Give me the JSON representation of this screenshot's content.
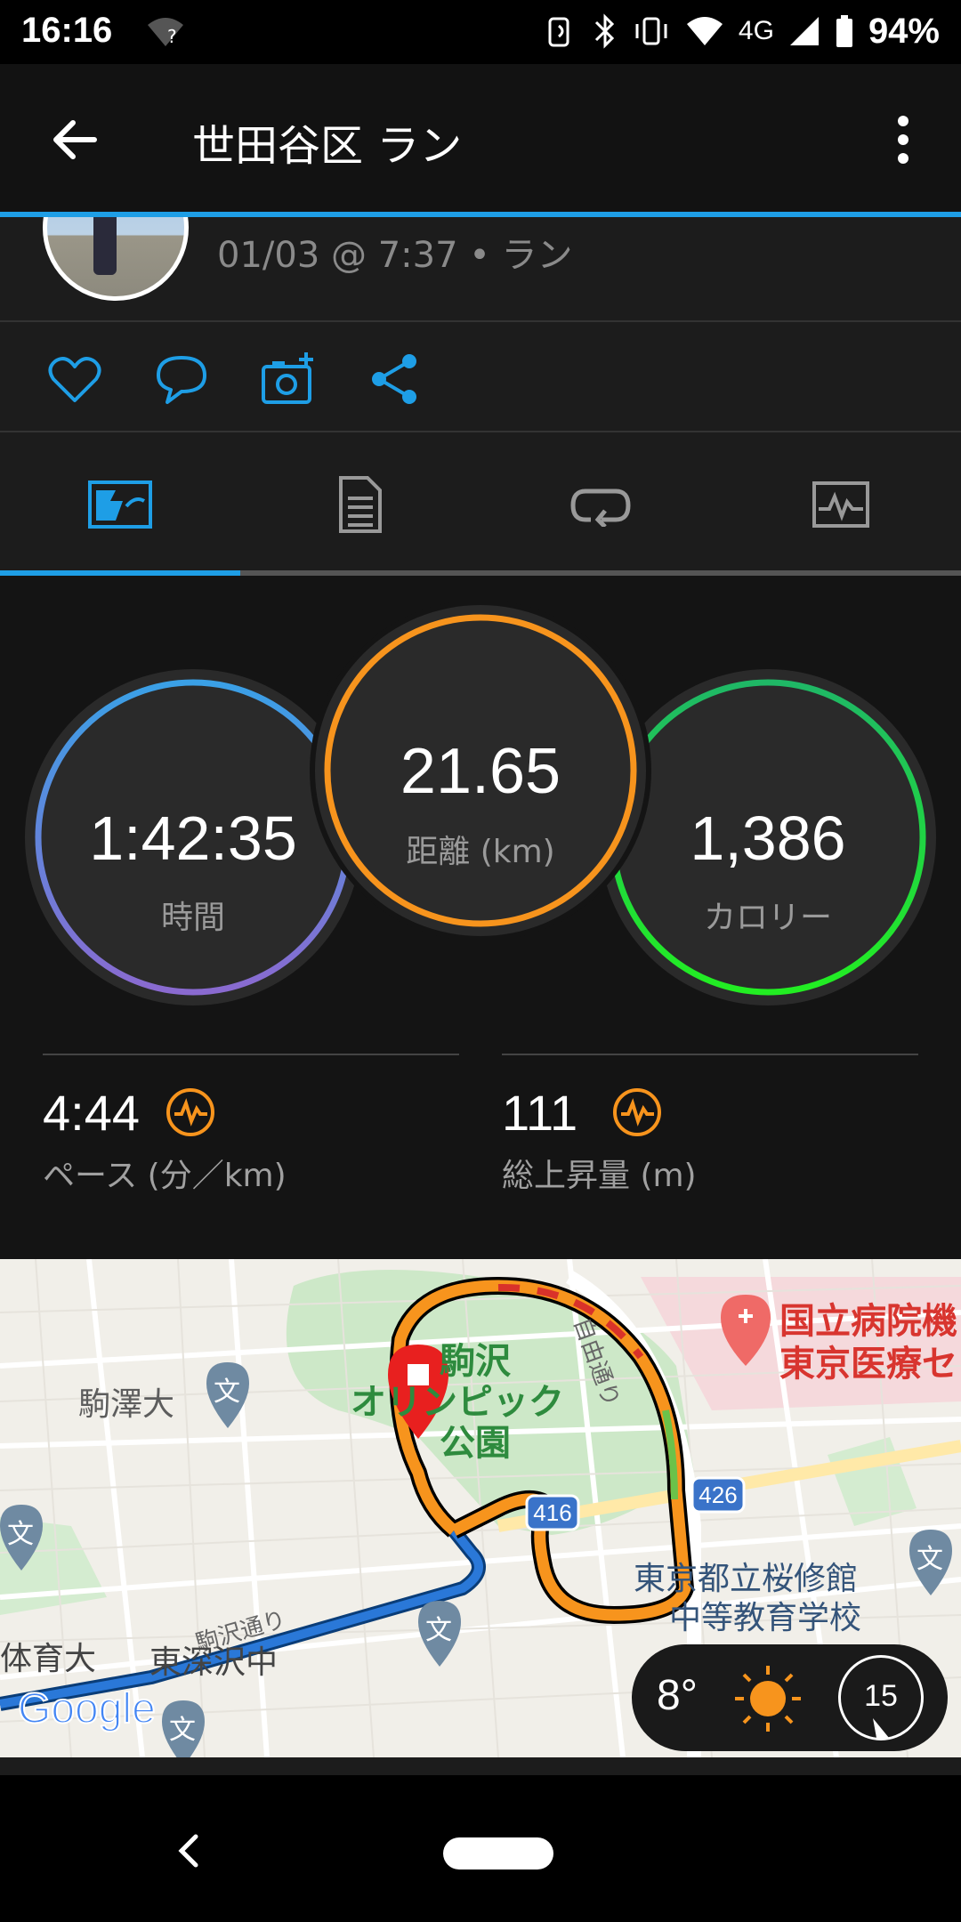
{
  "status_bar": {
    "time": "16:16",
    "battery": "94%",
    "network": "4G"
  },
  "app_bar": {
    "title": "世田谷区 ラン"
  },
  "activity": {
    "subtitle": "01/03 @ 7:37 • ラン"
  },
  "actions": [
    "heart-icon",
    "comment-icon",
    "add-photo-icon",
    "share-icon"
  ],
  "tabs": [
    {
      "icon": "overview-map-icon",
      "active": true
    },
    {
      "icon": "details-list-icon",
      "active": false
    },
    {
      "icon": "laps-icon",
      "active": false
    },
    {
      "icon": "chart-icon",
      "active": false
    }
  ],
  "rings": {
    "time": {
      "value": "1:42:35",
      "label": "時間"
    },
    "distance": {
      "value": "21.65",
      "label": "距離 (km)"
    },
    "calories": {
      "value": "1,386",
      "label": "カロリー"
    }
  },
  "metrics": {
    "pace": {
      "value": "4:44",
      "label": "ペース (分／km)"
    },
    "elevation": {
      "value": "111",
      "label": "総上昇量 (m)"
    }
  },
  "map": {
    "labels": {
      "park": [
        "駒沢",
        "オリンピック",
        "公園"
      ],
      "komazawa_univ": "駒澤大",
      "hospital_1": "国立病院機",
      "hospital_2": "東京医療セ",
      "jiyu_dori": "自由通り",
      "komazawa_dori": "駒沢通り",
      "school_1": "東京都立桜修館",
      "school_2": "中等教育学校",
      "taiiku": "体育大",
      "higashi": "東深沢中",
      "route_416": "416",
      "route_426": "426",
      "google": "Google",
      "school_glyph": "文"
    }
  },
  "weather": {
    "temp": "8°",
    "wind": "15"
  },
  "colors": {
    "accent": "#1e9ee6",
    "distance_ring": "#f7941d",
    "calorie_ring": "#22dd44"
  }
}
